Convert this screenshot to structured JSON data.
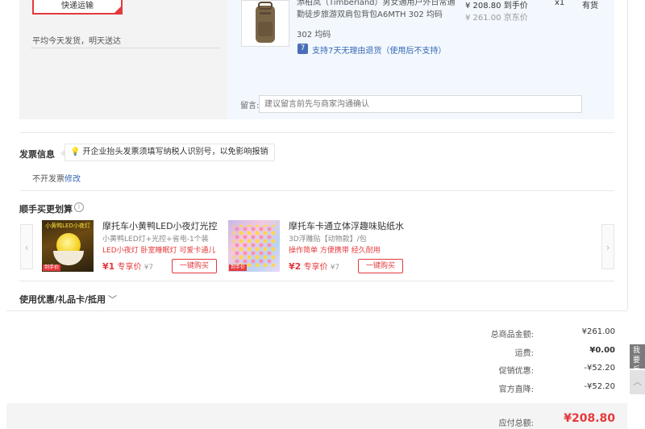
{
  "shipping": {
    "option_label": "快递运输",
    "note": "平均今天发货，明天送达"
  },
  "item": {
    "title": "添柏岚（Timberland）男女通用户外日常通勤徒步旅游双肩包背包A6MTH 302 均码",
    "variant": "302 均码",
    "price": "¥ 208.80 到手价",
    "jd_price": "¥ 261.00 京东价",
    "qty": "x1",
    "stock": "有货",
    "return_icon": "7",
    "return_policy": "支持7天无理由退货（使用后不支持）"
  },
  "remark": {
    "label": "留言:",
    "placeholder": "建议留言前先与商家沟通确认"
  },
  "invoice": {
    "title": "发票信息",
    "tip": "开企业抬头发票须填写纳税人识别号，以免影响报销",
    "status": "不开发票",
    "edit_label": "修改"
  },
  "addon": {
    "title": "顺手买更划算",
    "info_icon": "i",
    "prev_label": "‹",
    "next_label": "›",
    "products": [
      {
        "img_label": "小黄鸭LED小夜灯",
        "badge": "到手价",
        "name": "摩托车小黄鸭LED小夜灯光控",
        "sub": "小黄鸭LED灯+光控+省电-1个装",
        "promo": "LED小夜灯 卧室睡眠灯 可爱卡通儿",
        "price": "¥1",
        "price_tag": "专享价",
        "orig": "¥7",
        "buy_label": "一键购买"
      },
      {
        "img_label": "",
        "badge": "到手价",
        "name": "摩托车卡通立体浮趣味贴纸水",
        "sub": "3D浮雕贴【动物款】/包",
        "promo": "操作简单 方便携带 经久耐用",
        "price": "¥2",
        "price_tag": "专享价",
        "orig": "¥7",
        "buy_label": "一键购买"
      }
    ]
  },
  "coupon": {
    "label": "使用优惠/礼品卡/抵用",
    "chevron_icon": "chevron-down-icon"
  },
  "summary": {
    "rows": [
      {
        "label": "总商品金额:",
        "value": "¥261.00",
        "bold": false
      },
      {
        "label": "运费:",
        "value": "¥0.00",
        "bold": true
      },
      {
        "label": "促销优惠:",
        "value": "-¥52.20",
        "bold": false
      },
      {
        "label": "官方直降:",
        "value": "-¥52.20",
        "bold": false
      }
    ],
    "total_label": "应付总额:",
    "total_value": "¥208.80"
  },
  "side": {
    "feedback_label": "我要反馈",
    "top_icon": "︿"
  },
  "colors": {
    "accent": "#e4393c",
    "link": "#3567b5",
    "goods_bg": "#f3f8fe"
  }
}
